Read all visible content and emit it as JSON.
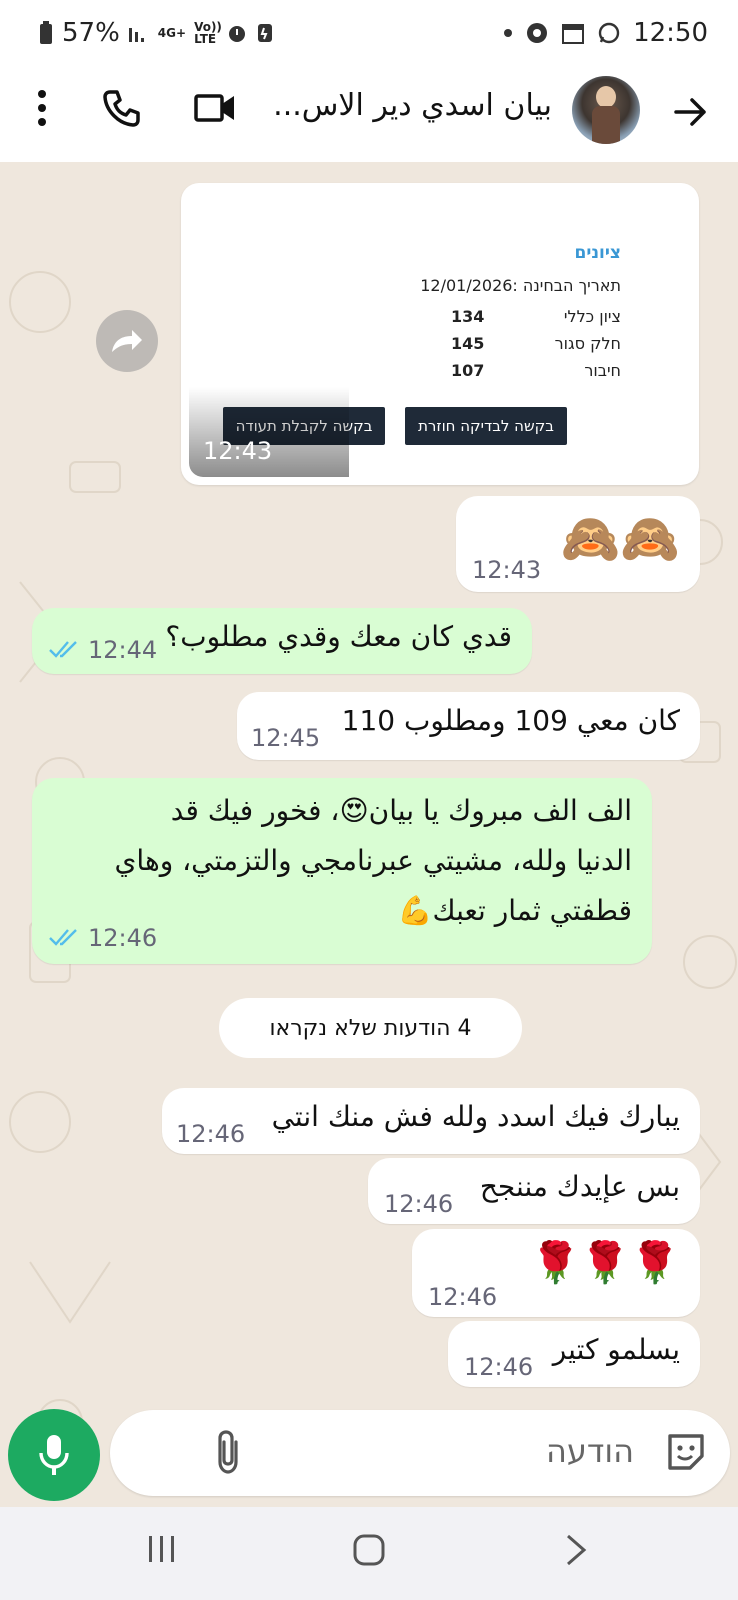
{
  "status_bar": {
    "battery": "57%",
    "network": "4G+",
    "volte": "Vo)) LTE",
    "time": "12:50"
  },
  "header": {
    "contact_name": "بيان اسدي دير الاس...",
    "icons": [
      "back-arrow-icon",
      "avatar",
      "video-call-icon",
      "voice-call-icon",
      "more-menu-icon"
    ]
  },
  "grades_card": {
    "title": "ציונים",
    "exam_date": "תאריך הבחינה :12/01/2026",
    "rows": [
      {
        "label": "ציון כללי",
        "value": "134"
      },
      {
        "label": "חלק סגור",
        "value": "145"
      },
      {
        "label": "חיבור",
        "value": "107"
      }
    ],
    "button_recheck": "בקשה לבדיקה חוזרת",
    "button_certificate": "בקשה לקבלת תעודה",
    "time": "12:43"
  },
  "messages": [
    {
      "id": "m1",
      "direction": "in",
      "text": "🙈🙈",
      "time": "12:43"
    },
    {
      "id": "m2",
      "direction": "out",
      "text": "قدي كان معك وقدي مطلوب؟",
      "time": "12:44",
      "read": true
    },
    {
      "id": "m3",
      "direction": "in",
      "text": "كان معي 109 ومطلوب 110",
      "time": "12:45"
    },
    {
      "id": "m4",
      "direction": "out",
      "lines": [
        "الف الف مبروك يا بيان😍، فخور فيك قد",
        "الدنيا ولله، مشيتي عبرنامجي والتزمتي، وهاي",
        "قطفتي ثمار تعبك💪"
      ],
      "time": "12:46",
      "read": true
    },
    {
      "id": "m5",
      "direction": "in",
      "text": "يبارك فيك اسدد ولله فش منك انتي",
      "time": "12:46"
    },
    {
      "id": "m6",
      "direction": "in",
      "text": "بس عإيدك مننجح",
      "time": "12:46"
    },
    {
      "id": "m7",
      "direction": "in",
      "text": "🌹🌹🌹",
      "time": "12:46"
    },
    {
      "id": "m8",
      "direction": "in",
      "text": "يسلمو كتير",
      "time": "12:46"
    }
  ],
  "unread_banner": "4 הודעות שלא נקראו",
  "composer": {
    "placeholder": "הודעה"
  },
  "colors": {
    "outgoing_bubble": "#d9fdd3",
    "incoming_bubble": "#ffffff",
    "chat_background": "#efe7dd",
    "mic_button": "#1daa61",
    "read_ticks": "#53bdeb"
  }
}
